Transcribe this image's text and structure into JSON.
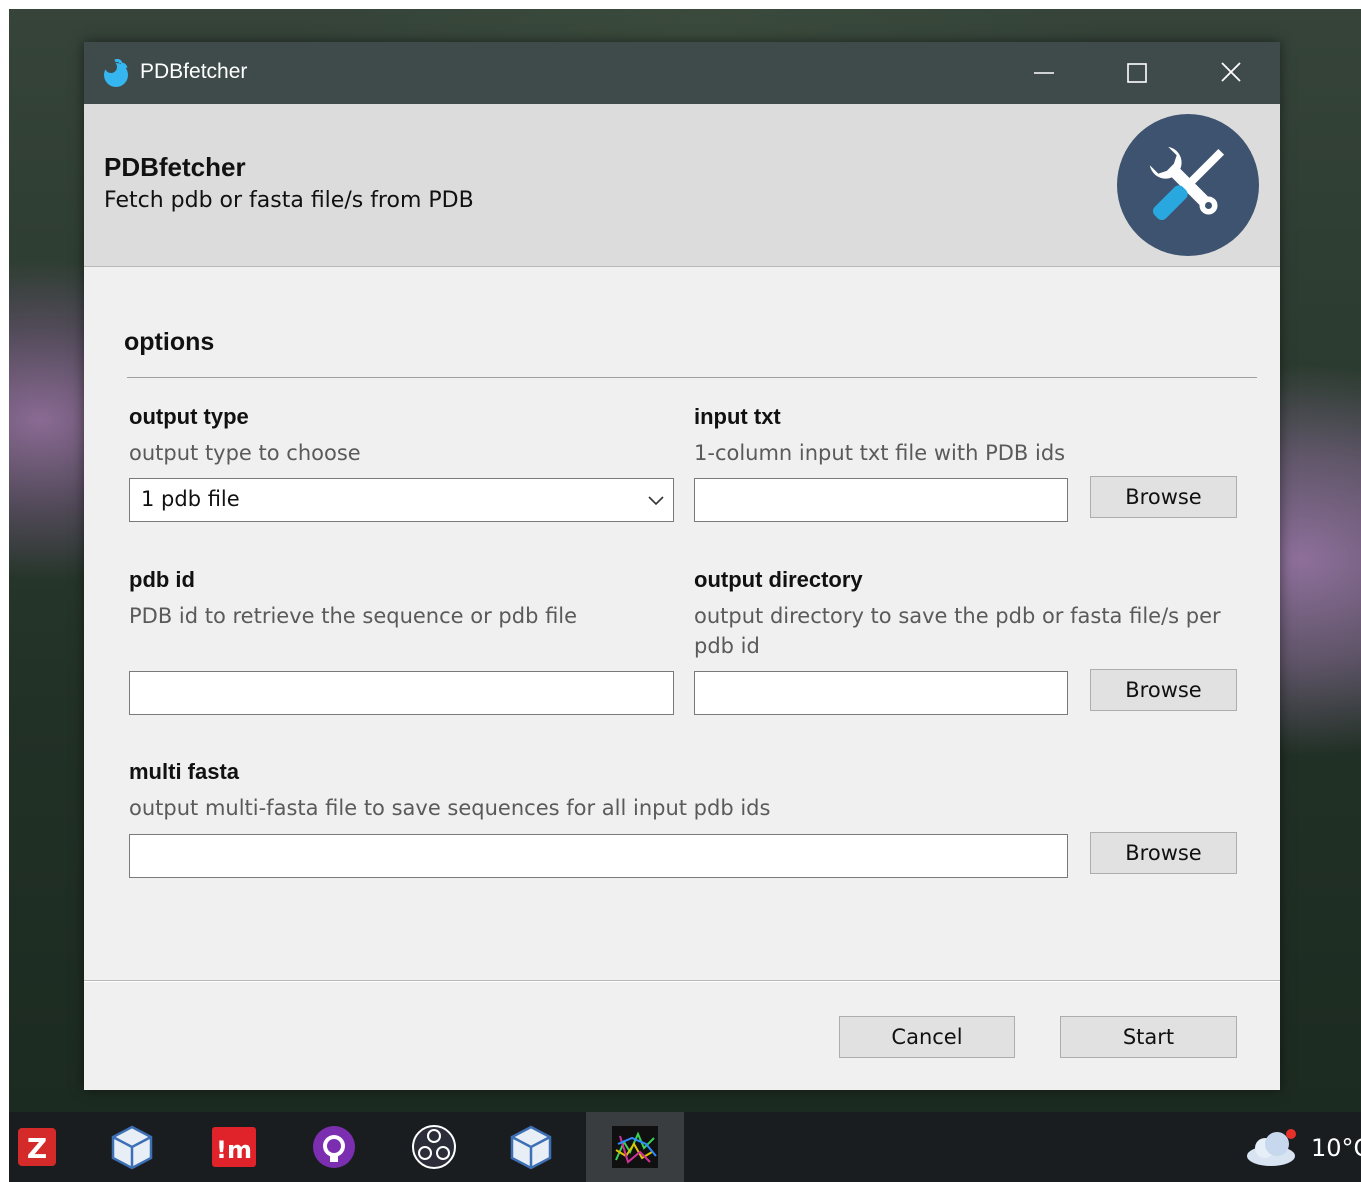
{
  "window": {
    "title": "PDBfetcher",
    "controls": [
      "minimize",
      "maximize",
      "close"
    ]
  },
  "header": {
    "title": "PDBfetcher",
    "subtitle": "Fetch pdb or fasta file/s from PDB"
  },
  "options": {
    "section_title": "options",
    "output_type": {
      "label": "output type",
      "description": "output type to choose",
      "selected": "1 pdb file"
    },
    "input_txt": {
      "label": "input txt",
      "description": "1-column input txt file with PDB ids",
      "value": "",
      "browse_label": "Browse"
    },
    "pdb_id": {
      "label": "pdb id",
      "description": "PDB id to retrieve the sequence or pdb file",
      "value": ""
    },
    "output_directory": {
      "label": "output directory",
      "description": "output directory to save the pdb or fasta file/s per pdb id",
      "value": "",
      "browse_label": "Browse"
    },
    "multi_fasta": {
      "label": "multi fasta",
      "description": "output multi-fasta file to save sequences for all input pdb ids",
      "value": "",
      "browse_label": "Browse"
    }
  },
  "footer": {
    "cancel_label": "Cancel",
    "start_label": "Start"
  },
  "taskbar": {
    "icons": [
      "zotero-icon",
      "virtualbox-icon",
      "imgur-icon",
      "github-icon",
      "obs-icon",
      "virtualbox-icon",
      "molecule-viewer-icon"
    ],
    "temperature": "10°C"
  },
  "colors": {
    "titlebar": "#3f4a4b",
    "header_bg": "#dcdcdc",
    "logo_circle": "#3d5370",
    "accent_blue": "#29a8e0"
  }
}
